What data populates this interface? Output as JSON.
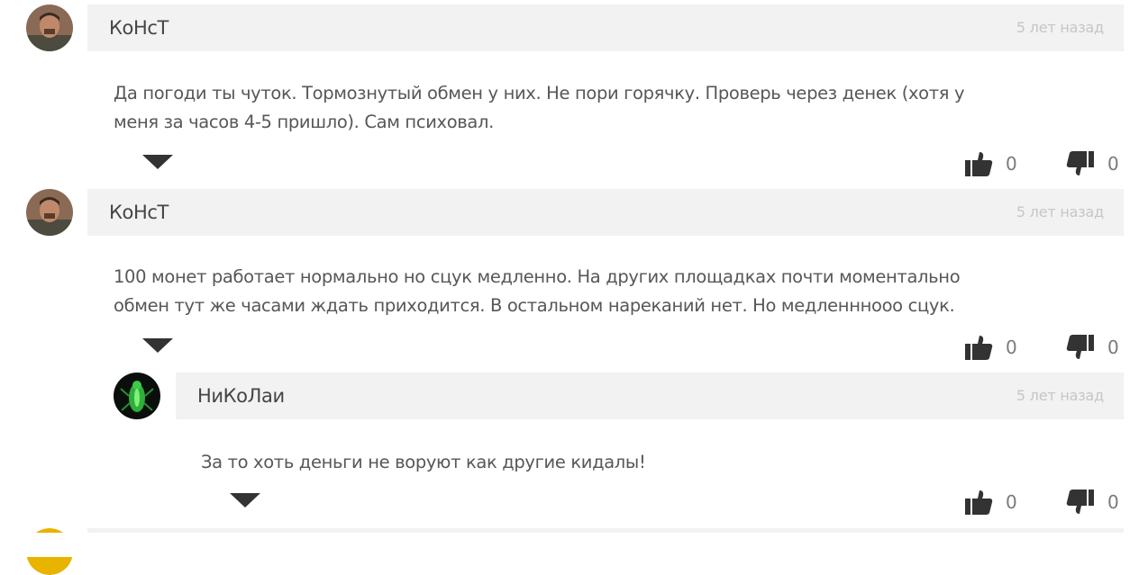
{
  "comments": [
    {
      "author": "КоНсТ",
      "time": "5 лет назад",
      "text_lines": [
        "Да погоди ты чуток. Тормознутый обмен у них. Не пори горячку. Проверь через денек (хотя у",
        "меня за часов 4-5 пришло). Сам психовал."
      ],
      "likes": "0",
      "dislikes": "0"
    },
    {
      "author": "КоНсТ",
      "time": "5 лет назад",
      "text_lines": [
        "100 монет работает нормально но сцук медленно. На других площадках почти моментально",
        "обмен тут же часами ждать приходится. В остальном нареканий нет. Но медленнноoo сцук."
      ],
      "likes": "0",
      "dislikes": "0"
    },
    {
      "author": "НиКоЛаи",
      "time": "5 лет назад",
      "text_lines": [
        "За то хоть деньги не воруют как другие кидалы!"
      ],
      "likes": "0",
      "dislikes": "0"
    }
  ],
  "icons": {
    "like": "thumbs-up-icon",
    "dislike": "thumbs-down-icon",
    "expand": "caret-down-icon"
  },
  "colors": {
    "header_bg": "#f2f2f2",
    "time": "#c6c6c6",
    "text": "#575757"
  }
}
